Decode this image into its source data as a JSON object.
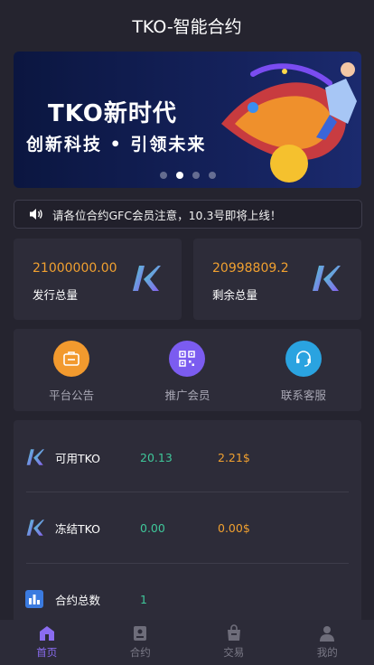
{
  "header": {
    "title": "TKO-智能合约"
  },
  "banner": {
    "line1": "TKO新时代",
    "line2": "创新科技 • 引领未来",
    "slides": 4,
    "active_slide": 1
  },
  "notice": {
    "icon": "speaker-icon",
    "text": "请各位合约GFC会员注意，10.3号即将上线！"
  },
  "stats": [
    {
      "value": "21000000.00",
      "label": "发行总量",
      "icon": "tko-logo-icon"
    },
    {
      "value": "20998809.2",
      "label": "剩余总量",
      "icon": "tko-logo-icon"
    }
  ],
  "menu": [
    {
      "label": "平台公告",
      "icon": "announcement-icon",
      "color": "#f29a2e"
    },
    {
      "label": "推广会员",
      "icon": "qrcode-icon",
      "color": "#7b5cf0"
    },
    {
      "label": "联系客服",
      "icon": "headset-icon",
      "color": "#2aa3e0"
    }
  ],
  "assets": [
    {
      "name": "可用TKO",
      "value": "20.13",
      "usd": "2.21$",
      "icon": "tko-logo-icon"
    },
    {
      "name": "冻结TKO",
      "value": "0.00",
      "usd": "0.00$",
      "icon": "tko-logo-icon"
    },
    {
      "name": "合约总数",
      "value": "1",
      "usd": "",
      "icon": "bar-chart-icon"
    }
  ],
  "tabbar": [
    {
      "label": "首页",
      "icon": "home-icon",
      "active": true
    },
    {
      "label": "合约",
      "icon": "contract-icon",
      "active": false
    },
    {
      "label": "交易",
      "icon": "trade-icon",
      "active": false
    },
    {
      "label": "我的",
      "icon": "user-icon",
      "active": false
    }
  ],
  "colors": {
    "background": "#25242f",
    "card": "#2d2c39",
    "accent": "#8a6cf0",
    "orange": "#f0a030",
    "green": "#3fc79a"
  }
}
